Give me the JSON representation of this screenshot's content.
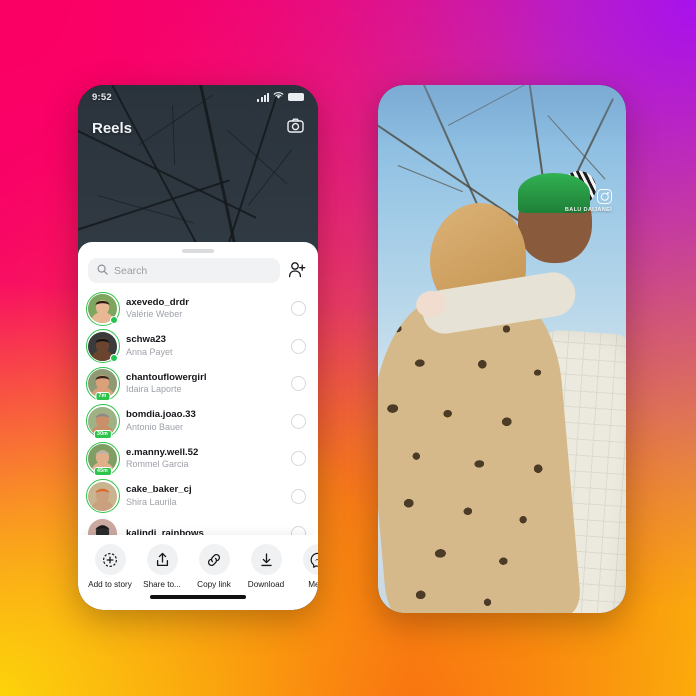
{
  "background": {
    "gradient_colors": [
      "#FA0064",
      "#A811ED",
      "#F96A11",
      "#FCC409"
    ]
  },
  "left_phone": {
    "name": "instagram-reels-share-sheet",
    "status_bar": {
      "time": "9:52",
      "icons": [
        "cellular-signal-icon",
        "wifi-icon",
        "battery-icon"
      ]
    },
    "header": {
      "title": "Reels",
      "camera_icon": "camera-icon"
    },
    "share_sheet": {
      "grabber": "drag-handle",
      "search": {
        "placeholder": "Search",
        "icon": "search-icon"
      },
      "add_people_icon": "add-people-icon",
      "contacts": [
        {
          "username": "axevedo_drdr",
          "fullname": "Valérie Weber",
          "online": true,
          "story_ring": true,
          "time_badge": ""
        },
        {
          "username": "schwa23",
          "fullname": "Anna Payet",
          "online": true,
          "story_ring": true,
          "time_badge": ""
        },
        {
          "username": "chantouflowergirl",
          "fullname": "Idaira Laporte",
          "online": false,
          "story_ring": true,
          "time_badge": "7m"
        },
        {
          "username": "bomdia.joao.33",
          "fullname": "Antonio Bauer",
          "online": false,
          "story_ring": true,
          "time_badge": "30m"
        },
        {
          "username": "e.manny.well.52",
          "fullname": "Rommel Garcia",
          "online": false,
          "story_ring": true,
          "time_badge": "45m"
        },
        {
          "username": "cake_baker_cj",
          "fullname": "Shira Laurila",
          "online": false,
          "story_ring": true,
          "time_badge": ""
        },
        {
          "username": "kalindi_rainbows",
          "fullname": "",
          "online": false,
          "story_ring": false,
          "time_badge": ""
        }
      ],
      "actions": [
        {
          "label": "Add to story",
          "icon": "add-to-story-icon"
        },
        {
          "label": "Share to...",
          "icon": "share-icon"
        },
        {
          "label": "Copy link",
          "icon": "link-icon"
        },
        {
          "label": "Download",
          "icon": "download-icon"
        },
        {
          "label": "Mess",
          "icon": "messenger-icon"
        }
      ]
    }
  },
  "right_phone": {
    "name": "instagram-reel-playing",
    "watermark": {
      "logo_icon": "instagram-logo-icon",
      "username": "BALU DAIJANEI"
    }
  }
}
